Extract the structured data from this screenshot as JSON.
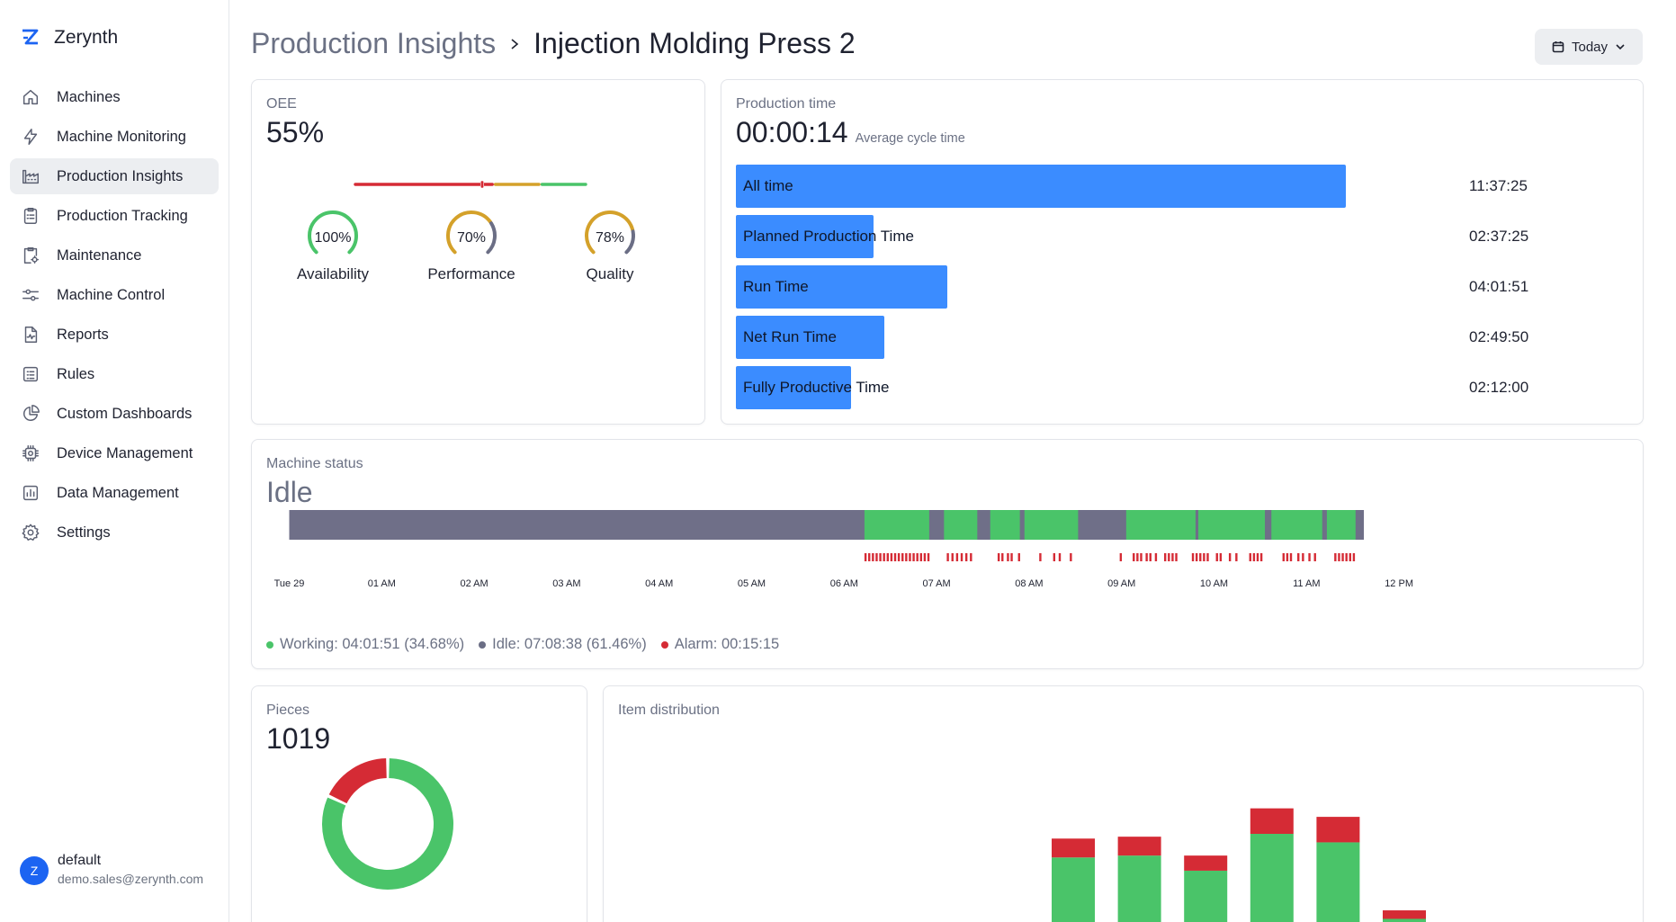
{
  "brand": {
    "name": "Zerynth"
  },
  "sidebar": {
    "items": [
      {
        "label": "Machines",
        "icon": "home-icon"
      },
      {
        "label": "Machine Monitoring",
        "icon": "lightning-icon"
      },
      {
        "label": "Production Insights",
        "icon": "factory-icon",
        "active": true
      },
      {
        "label": "Production Tracking",
        "icon": "clipboard-icon"
      },
      {
        "label": "Maintenance",
        "icon": "maintenance-clipboard-icon"
      },
      {
        "label": "Machine Control",
        "icon": "sliders-icon"
      },
      {
        "label": "Reports",
        "icon": "report-icon"
      },
      {
        "label": "Rules",
        "icon": "rules-list-icon"
      },
      {
        "label": "Custom Dashboards",
        "icon": "pie-chart-icon"
      },
      {
        "label": "Device Management",
        "icon": "chip-icon"
      },
      {
        "label": "Data Management",
        "icon": "bar-chart-icon"
      },
      {
        "label": "Settings",
        "icon": "gear-icon"
      }
    ]
  },
  "user": {
    "initial": "Z",
    "name": "default",
    "email": "demo.sales@zerynth.com"
  },
  "header": {
    "parent": "Production Insights",
    "current": "Injection Molding Press 2",
    "date_filter": "Today"
  },
  "oee": {
    "label": "OEE",
    "value": "55%",
    "metrics": [
      {
        "label": "Availability",
        "value": "100%",
        "fraction": 1.0,
        "color": "#4ac469"
      },
      {
        "label": "Performance",
        "value": "70%",
        "fraction": 0.7,
        "color": "#d4a12a"
      },
      {
        "label": "Quality",
        "value": "78%",
        "fraction": 0.78,
        "color": "#d4a12a"
      }
    ],
    "scale": {
      "marker_fraction": 0.55,
      "red_until": 0.6,
      "yellow_until": 0.8,
      "colors": [
        "#d52b35",
        "#d4a12a",
        "#4ac469"
      ]
    }
  },
  "production_time": {
    "label": "Production time",
    "value": "00:00:14",
    "caption": "Average cycle time",
    "rows": [
      {
        "label": "All time",
        "value": "11:37:25",
        "hours": 11.624
      },
      {
        "label": "Planned Production Time",
        "value": "02:37:25",
        "hours": 2.624
      },
      {
        "label": "Run Time",
        "value": "04:01:51",
        "hours": 4.031
      },
      {
        "label": "Net Run Time",
        "value": "02:49:50",
        "hours": 2.831
      },
      {
        "label": "Fully Productive Time",
        "value": "02:12:00",
        "hours": 2.2
      }
    ]
  },
  "machine_status": {
    "label": "Machine status",
    "value": "Idle",
    "legend": [
      {
        "label": "Working: 04:01:51 (34.68%)",
        "color": "#4ac469"
      },
      {
        "label": "Idle: 07:08:38 (61.46%)",
        "color": "#6b6e85"
      },
      {
        "label": "Alarm: 00:15:15",
        "color": "#d52b35"
      }
    ],
    "ticks": [
      "Tue 29",
      "01 AM",
      "02 AM",
      "03 AM",
      "04 AM",
      "05 AM",
      "06 AM",
      "07 AM",
      "08 AM",
      "09 AM",
      "10 AM",
      "11 AM",
      "12 PM"
    ],
    "colors": {
      "working": "#4ac469",
      "idle": "#6f6f88",
      "alarm": "#d52b35"
    },
    "working_intervals_hours": [
      [
        6.22,
        6.92
      ],
      [
        7.08,
        7.44
      ],
      [
        7.58,
        7.9
      ],
      [
        7.95,
        8.53
      ],
      [
        9.05,
        9.8
      ],
      [
        9.83,
        10.55
      ],
      [
        10.62,
        11.17
      ],
      [
        11.22,
        11.53
      ]
    ],
    "end_hours": 11.62,
    "alarm_hours": [
      6.22,
      6.26,
      6.3,
      6.34,
      6.38,
      6.42,
      6.46,
      6.5,
      6.54,
      6.58,
      6.62,
      6.66,
      6.7,
      6.74,
      6.78,
      6.82,
      6.86,
      6.9,
      7.11,
      7.16,
      7.21,
      7.26,
      7.31,
      7.36,
      7.66,
      7.7,
      7.76,
      7.8,
      7.88,
      8.11,
      8.26,
      8.32,
      8.44,
      8.98,
      9.12,
      9.16,
      9.2,
      9.26,
      9.3,
      9.36,
      9.46,
      9.5,
      9.54,
      9.58,
      9.76,
      9.8,
      9.84,
      9.88,
      9.92,
      10.02,
      10.06,
      10.16,
      10.23,
      10.38,
      10.42,
      10.46,
      10.5,
      10.74,
      10.78,
      10.82,
      10.9,
      10.95,
      11.02,
      11.08,
      11.3,
      11.34,
      11.38,
      11.42,
      11.46,
      11.5
    ]
  },
  "pieces": {
    "label": "Pieces",
    "value": "1019",
    "good_fraction": 0.82,
    "colors": {
      "good": "#4ac469",
      "bad": "#d52b35"
    }
  },
  "item_distribution": {
    "label": "Item distribution"
  },
  "chart_data": {
    "type": "bar",
    "stacked": true,
    "categories": [
      "",
      "",
      "",
      "",
      "",
      ""
    ],
    "series": [
      {
        "color": "#4ac469",
        "values": [
          95,
          97,
          81,
          120,
          111,
          30
        ]
      },
      {
        "color": "#d52b35",
        "values": [
          20,
          20,
          16,
          27,
          27,
          9
        ]
      }
    ],
    "ylim": [
      0,
      160
    ]
  }
}
